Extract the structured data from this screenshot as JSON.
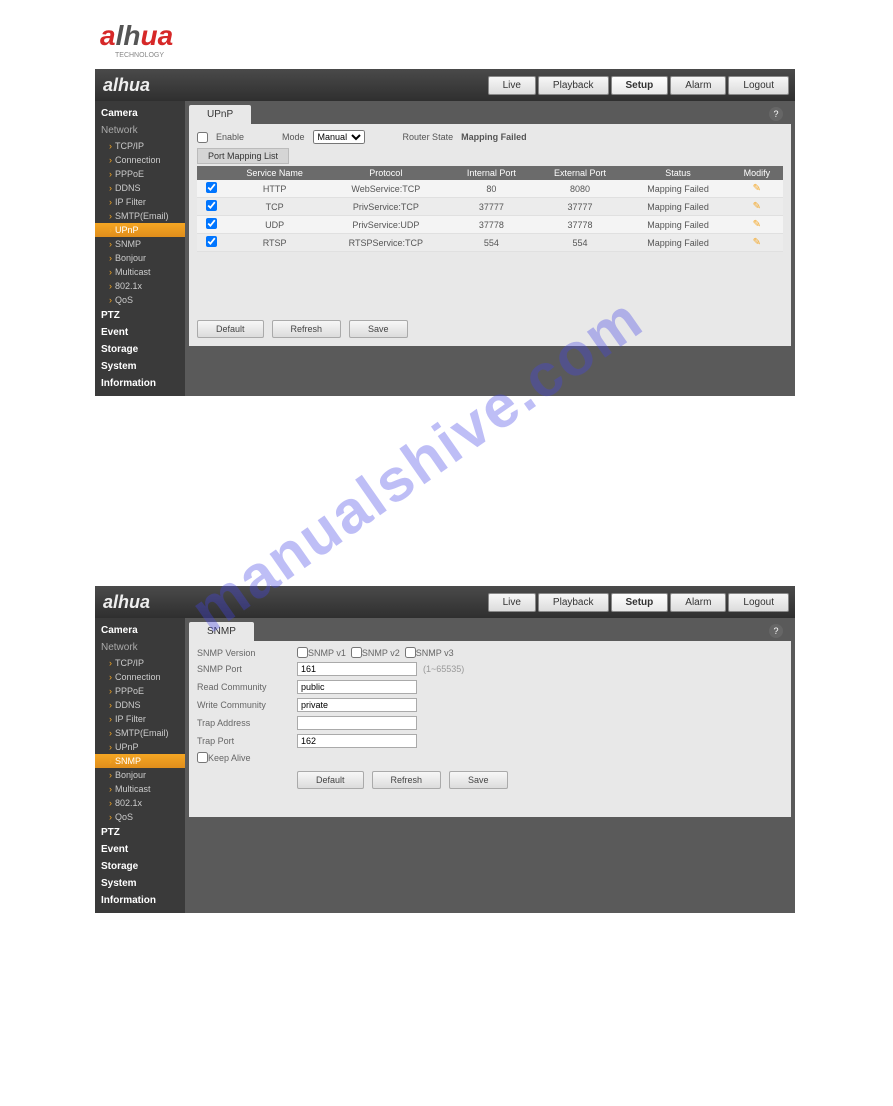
{
  "brand": "alhua",
  "brand_sub": "TECHNOLOGY",
  "top_tabs": [
    "Live",
    "Playback",
    "Setup",
    "Alarm",
    "Logout"
  ],
  "top_active": "Setup",
  "watermark": "manualshive.com",
  "sidebar": {
    "camera": "Camera",
    "network": "Network",
    "net_items": [
      "TCP/IP",
      "Connection",
      "PPPoE",
      "DDNS",
      "IP Filter",
      "SMTP(Email)",
      "UPnP",
      "SNMP",
      "Bonjour",
      "Multicast",
      "802.1x",
      "QoS"
    ],
    "ptz": "PTZ",
    "event": "Event",
    "storage": "Storage",
    "system": "System",
    "information": "Information",
    "active1": "UPnP",
    "active2": "SNMP"
  },
  "upnp": {
    "tab": "UPnP",
    "enable": "Enable",
    "mode_lbl": "Mode",
    "mode_val": "Manual",
    "router_lbl": "Router State",
    "router_val": "Mapping Failed",
    "subtab": "Port Mapping List",
    "headers": [
      "",
      "Service Name",
      "Protocol",
      "Internal Port",
      "External Port",
      "Status",
      "Modify"
    ],
    "rows": [
      {
        "name": "HTTP",
        "proto": "WebService:TCP",
        "in": "80",
        "out": "8080",
        "status": "Mapping Failed"
      },
      {
        "name": "TCP",
        "proto": "PrivService:TCP",
        "in": "37777",
        "out": "37777",
        "status": "Mapping Failed"
      },
      {
        "name": "UDP",
        "proto": "PrivService:UDP",
        "in": "37778",
        "out": "37778",
        "status": "Mapping Failed"
      },
      {
        "name": "RTSP",
        "proto": "RTSPService:TCP",
        "in": "554",
        "out": "554",
        "status": "Mapping Failed"
      }
    ],
    "buttons": {
      "default": "Default",
      "refresh": "Refresh",
      "save": "Save"
    }
  },
  "snmp": {
    "tab": "SNMP",
    "version_lbl": "SNMP Version",
    "v1": "SNMP v1",
    "v2": "SNMP v2",
    "v3": "SNMP v3",
    "port_lbl": "SNMP Port",
    "port_val": "161",
    "port_hint": "(1~65535)",
    "read_lbl": "Read Community",
    "read_val": "public",
    "write_lbl": "Write Community",
    "write_val": "private",
    "trap_addr_lbl": "Trap Address",
    "trap_addr_val": "",
    "trap_port_lbl": "Trap Port",
    "trap_port_val": "162",
    "keep_alive": "Keep Alive",
    "buttons": {
      "default": "Default",
      "refresh": "Refresh",
      "save": "Save"
    }
  }
}
